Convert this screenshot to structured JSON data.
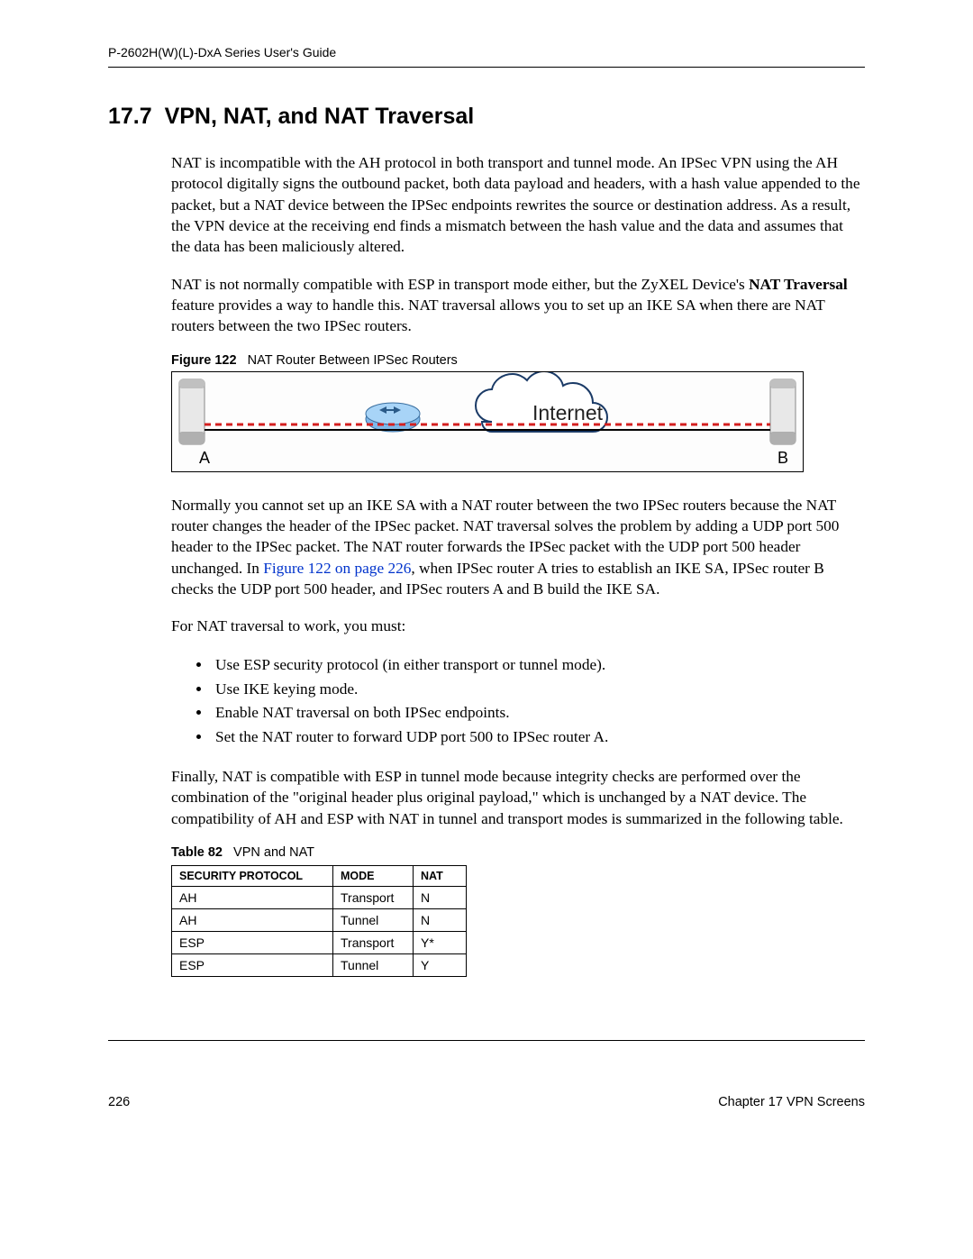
{
  "header": {
    "guide_title": "P-2602H(W)(L)-DxA Series User's Guide"
  },
  "section": {
    "number": "17.7",
    "title": "VPN, NAT, and NAT Traversal"
  },
  "paragraphs": {
    "p1": "NAT is incompatible with the AH protocol in both transport and tunnel mode. An IPSec VPN using the AH protocol digitally signs the outbound packet, both data payload and headers, with a hash value appended to the packet, but a NAT device between the IPSec endpoints rewrites the source or destination address. As a result, the VPN device at the receiving end finds a mismatch between the hash value and the data and assumes that the data has been maliciously altered.",
    "p2_pre": "NAT is not normally compatible with ESP in transport mode either, but the ZyXEL Device's ",
    "p2_bold": "NAT Traversal",
    "p2_post": " feature provides a way to handle this. NAT traversal allows you to set up an IKE SA when there are NAT routers between the two IPSec routers.",
    "p3_pre": "Normally you cannot set up an IKE SA with a NAT router between the two IPSec routers because the NAT router changes the header of the IPSec packet. NAT traversal solves the problem by adding a UDP port 500 header to the IPSec packet. The NAT router forwards the IPSec packet with the UDP port 500 header unchanged. In ",
    "p3_link": "Figure 122 on page 226",
    "p3_post": ", when IPSec router A tries to establish an IKE SA, IPSec router B checks the UDP port 500 header, and IPSec routers A and B build the IKE SA.",
    "p4": "For NAT traversal to work, you must:",
    "p5": "Finally, NAT is compatible with ESP in tunnel mode because integrity checks are performed over the combination of the \"original header plus original payload,\" which is unchanged by a NAT device. The compatibility of AH and ESP with NAT in tunnel and transport modes is summarized in the following table."
  },
  "figure": {
    "label": "Figure 122",
    "caption": "NAT Router Between IPSec Routers",
    "node_a": "A",
    "node_b": "B",
    "internet": "Internet"
  },
  "list": {
    "items": [
      "Use ESP security protocol (in either transport or tunnel mode).",
      "Use IKE keying mode.",
      "Enable NAT traversal on both IPSec endpoints.",
      "Set the NAT router to forward UDP port 500 to IPSec router A."
    ]
  },
  "table": {
    "label": "Table 82",
    "caption": "VPN and NAT",
    "headers": [
      "SECURITY PROTOCOL",
      "MODE",
      "NAT"
    ],
    "rows": [
      [
        "AH",
        "Transport",
        "N"
      ],
      [
        "AH",
        "Tunnel",
        "N"
      ],
      [
        "ESP",
        "Transport",
        "Y*"
      ],
      [
        "ESP",
        "Tunnel",
        "Y"
      ]
    ]
  },
  "footer": {
    "page": "226",
    "chapter": "Chapter 17 VPN Screens"
  }
}
